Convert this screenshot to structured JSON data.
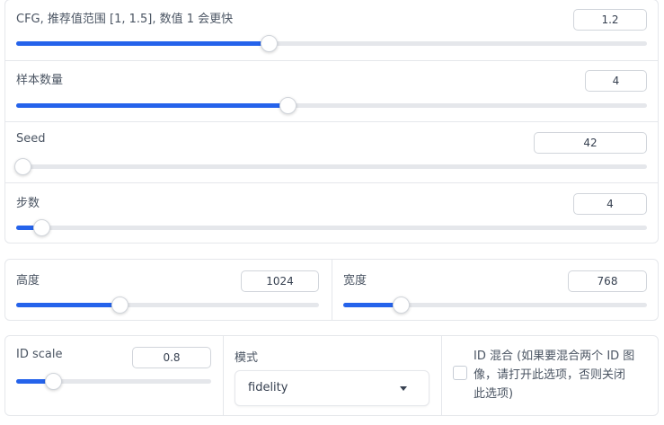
{
  "accent_color": "#2563eb",
  "panel1": {
    "cfg": {
      "label": "CFG, 推荐值范围 [1, 1.5], 数值 1 会更快",
      "value": "1.2",
      "fill_percent": 40
    },
    "num_samples": {
      "label": "样本数量",
      "value": "4",
      "fill_percent": 43
    },
    "seed": {
      "label": "Seed",
      "value": "42",
      "fill_percent": 1
    },
    "steps": {
      "label": "步数",
      "value": "4",
      "fill_percent": 4
    }
  },
  "panel2": {
    "height": {
      "label": "高度",
      "value": "1024",
      "fill_percent": 34
    },
    "width": {
      "label": "宽度",
      "value": "768",
      "fill_percent": 19
    }
  },
  "panel3": {
    "id_scale": {
      "label": "ID scale",
      "value": "0.8",
      "fill_percent": 19
    },
    "mode": {
      "label": "模式",
      "selected": "fidelity",
      "icon": "chevron-down-icon"
    },
    "id_mix": {
      "label_lines": [
        "ID 混合 (如果要混合两个 ID 图",
        "像，请打开此选项，否则关闭",
        "此选项)"
      ],
      "checked": false
    }
  }
}
